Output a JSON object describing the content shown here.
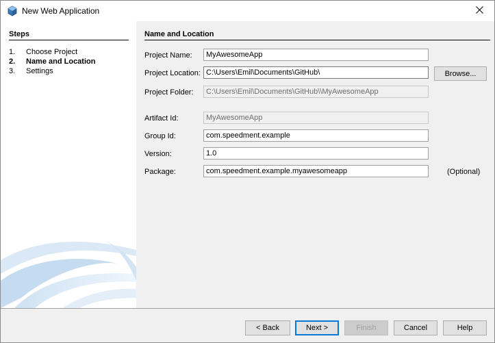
{
  "window": {
    "title": "New Web Application",
    "close_symbol": "✕"
  },
  "steps": {
    "title": "Steps",
    "items": [
      {
        "num": "1.",
        "label": "Choose Project"
      },
      {
        "num": "2.",
        "label": "Name and Location"
      },
      {
        "num": "3.",
        "label": "Settings"
      }
    ]
  },
  "section": {
    "title": "Name and Location"
  },
  "form": {
    "project_name_label": "Project Name:",
    "project_name_value": "MyAwesomeApp",
    "project_location_label": "Project Location:",
    "project_location_value": "C:\\Users\\Emil\\Documents\\GitHub\\",
    "browse_label": "Browse...",
    "project_folder_label": "Project Folder:",
    "project_folder_value": "C:\\Users\\Emil\\Documents\\GitHub\\\\MyAwesomeApp",
    "artifact_id_label": "Artifact Id:",
    "artifact_id_value": "MyAwesomeApp",
    "group_id_label": "Group Id:",
    "group_id_value": "com.speedment.example",
    "version_label": "Version:",
    "version_value": "1.0",
    "package_label": "Package:",
    "package_value": "com.speedment.example.myawesomeapp",
    "optional_label": "(Optional)"
  },
  "buttons": {
    "back": "< Back",
    "next": "Next >",
    "finish": "Finish",
    "cancel": "Cancel",
    "help": "Help"
  },
  "icons": {
    "app": "netbeans-cube-icon",
    "close": "close-icon"
  }
}
